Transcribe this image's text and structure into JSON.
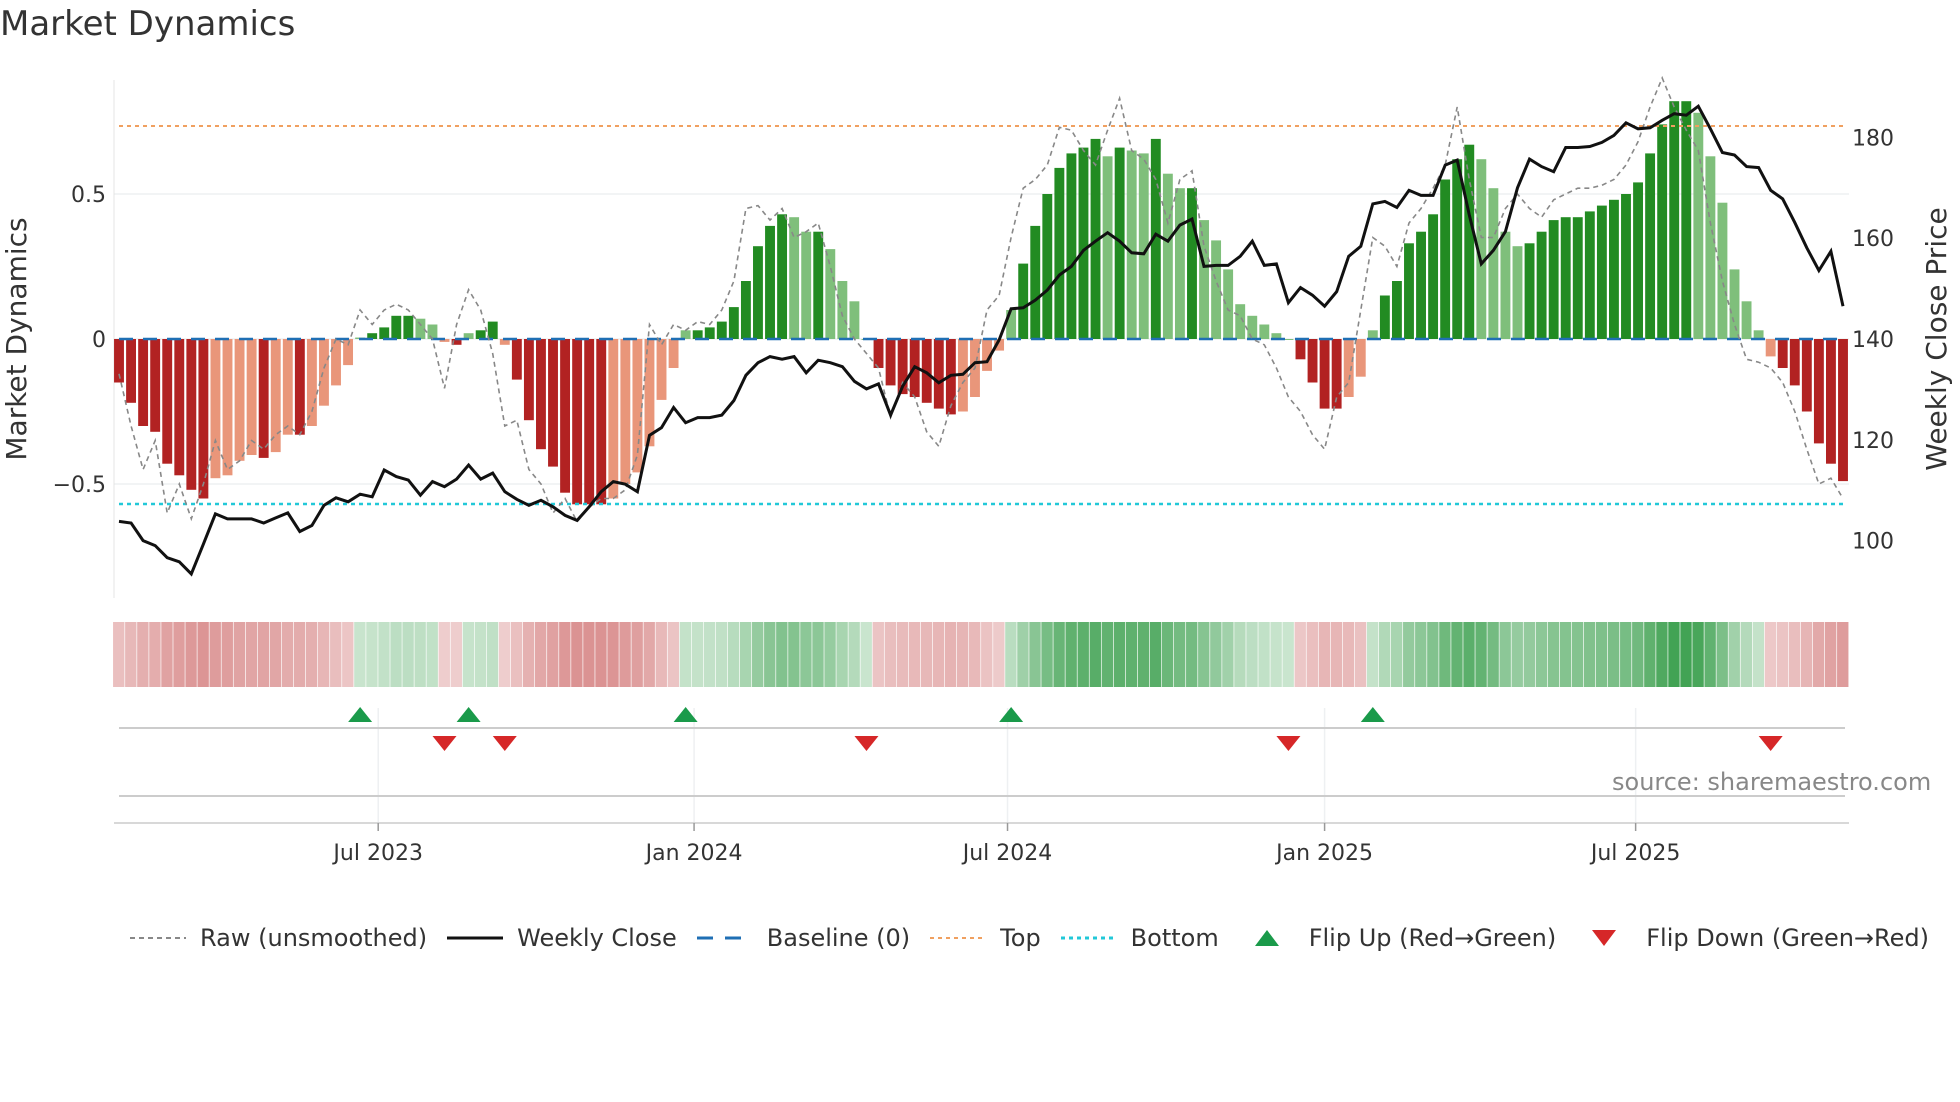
{
  "title": "Market Dynamics",
  "source": "source: sharemaestro.com",
  "legend": {
    "raw": "Raw (unsmoothed)",
    "close": "Weekly Close",
    "baseline": "Baseline (0)",
    "top": "Top",
    "bottom": "Bottom",
    "flip_up": "Flip Up (Red→Green)",
    "flip_down": "Flip Down (Green→Red)"
  },
  "colors": {
    "dark_green": "#228b22",
    "light_green": "#7fbf7b",
    "dark_red": "#b22222",
    "light_red": "#e9967a",
    "top": "#f0a060",
    "bottom": "#22c8d8",
    "baseline": "#1f6fb4",
    "up_marker": "#1a9a4a",
    "down_marker": "#d62728"
  },
  "chart_data": {
    "type": "bar",
    "title": "Market Dynamics",
    "ylabel": "Market Dynamics",
    "y2label": "Weekly Close Price",
    "ylim": [
      -0.9,
      0.9
    ],
    "y2lim": [
      90,
      190
    ],
    "yticks": [
      "0.5",
      "0",
      "−0.5"
    ],
    "yticks_values": [
      0.5,
      0,
      -0.5
    ],
    "y2ticks": [
      "180",
      "160",
      "140",
      "120",
      "100"
    ],
    "y2ticks_values": [
      180,
      160,
      140,
      120,
      100
    ],
    "xticks": [
      "Jul 2023",
      "Jan 2024",
      "Jul 2024",
      "Jan 2025",
      "Jul 2025"
    ],
    "xticks_week_index": [
      21.5,
      47.7,
      73.7,
      100,
      125.8
    ],
    "top_level": 0.73,
    "bottom_level": -0.57,
    "baseline": 0,
    "frequency": "weekly",
    "dynamics": [
      -0.15,
      -0.22,
      -0.3,
      -0.32,
      -0.43,
      -0.47,
      -0.52,
      -0.55,
      -0.48,
      -0.47,
      -0.42,
      -0.4,
      -0.41,
      -0.39,
      -0.33,
      -0.33,
      -0.3,
      -0.23,
      -0.16,
      -0.09,
      0.005,
      0.02,
      0.04,
      0.08,
      0.08,
      0.07,
      0.05,
      -0.01,
      -0.02,
      0.02,
      0.03,
      0.06,
      -0.02,
      -0.14,
      -0.28,
      -0.38,
      -0.44,
      -0.53,
      -0.57,
      -0.57,
      -0.57,
      -0.55,
      -0.5,
      -0.46,
      -0.37,
      -0.21,
      -0.1,
      0.03,
      0.03,
      0.04,
      0.06,
      0.11,
      0.2,
      0.32,
      0.39,
      0.43,
      0.42,
      0.37,
      0.37,
      0.31,
      0.2,
      0.13,
      0.0,
      -0.1,
      -0.16,
      -0.19,
      -0.2,
      -0.22,
      -0.24,
      -0.26,
      -0.25,
      -0.2,
      -0.11,
      -0.04,
      0.1,
      0.26,
      0.39,
      0.5,
      0.59,
      0.64,
      0.66,
      0.69,
      0.63,
      0.66,
      0.65,
      0.64,
      0.69,
      0.57,
      0.52,
      0.52,
      0.41,
      0.34,
      0.24,
      0.12,
      0.08,
      0.05,
      0.02,
      0.0,
      -0.07,
      -0.15,
      -0.24,
      -0.24,
      -0.2,
      -0.13,
      0.03,
      0.15,
      0.2,
      0.33,
      0.37,
      0.43,
      0.55,
      0.62,
      0.67,
      0.62,
      0.52,
      0.37,
      0.32,
      0.33,
      0.37,
      0.41,
      0.42,
      0.42,
      0.44,
      0.46,
      0.48,
      0.5,
      0.54,
      0.64,
      0.74,
      0.82,
      0.82,
      0.78,
      0.63,
      0.47,
      0.24,
      0.13,
      0.03,
      -0.06,
      -0.1,
      -0.16,
      -0.25,
      -0.36,
      -0.43,
      -0.49
    ],
    "raw": [
      -0.12,
      -0.3,
      -0.45,
      -0.35,
      -0.6,
      -0.5,
      -0.62,
      -0.5,
      -0.35,
      -0.45,
      -0.42,
      -0.35,
      -0.38,
      -0.33,
      -0.3,
      -0.33,
      -0.25,
      -0.1,
      0.0,
      -0.02,
      0.1,
      0.05,
      0.1,
      0.12,
      0.1,
      0.05,
      0.0,
      -0.17,
      0.05,
      0.17,
      0.1,
      -0.05,
      -0.3,
      -0.28,
      -0.45,
      -0.5,
      -0.6,
      -0.55,
      -0.63,
      -0.58,
      -0.55,
      -0.55,
      -0.52,
      -0.4,
      0.05,
      -0.02,
      0.05,
      0.03,
      0.06,
      0.05,
      0.1,
      0.2,
      0.45,
      0.46,
      0.41,
      0.45,
      0.35,
      0.37,
      0.4,
      0.25,
      0.08,
      0.0,
      -0.05,
      -0.1,
      -0.27,
      -0.15,
      -0.2,
      -0.32,
      -0.37,
      -0.23,
      -0.15,
      -0.1,
      0.1,
      0.15,
      0.35,
      0.52,
      0.55,
      0.6,
      0.73,
      0.72,
      0.65,
      0.6,
      0.72,
      0.83,
      0.65,
      0.62,
      0.55,
      0.4,
      0.55,
      0.58,
      0.32,
      0.2,
      0.1,
      0.08,
      0.0,
      -0.02,
      -0.1,
      -0.2,
      -0.25,
      -0.33,
      -0.38,
      -0.2,
      -0.15,
      0.1,
      0.35,
      0.32,
      0.25,
      0.4,
      0.45,
      0.52,
      0.6,
      0.8,
      0.55,
      0.35,
      0.35,
      0.45,
      0.5,
      0.45,
      0.42,
      0.48,
      0.5,
      0.52,
      0.52,
      0.53,
      0.55,
      0.6,
      0.68,
      0.8,
      0.9,
      0.8,
      0.72,
      0.65,
      0.4,
      0.2,
      0.05,
      -0.07,
      -0.08,
      -0.1,
      -0.15,
      -0.25,
      -0.38,
      -0.5,
      -0.48,
      -0.55
    ],
    "weekly_close": [
      103.8,
      103.5,
      100,
      99,
      96.6,
      95.8,
      93.4,
      99.3,
      105.3,
      104.3,
      104.3,
      104.3,
      103.5,
      104.5,
      105.5,
      101.8,
      103,
      107,
      108.5,
      107.7,
      109.2,
      108.7,
      114,
      112.7,
      112,
      109,
      111.7,
      110.7,
      112.2,
      115,
      112.2,
      113.4,
      109.7,
      108.2,
      107,
      108,
      106.7,
      105,
      104,
      106.7,
      109.7,
      111.7,
      111.2,
      109.7,
      120.9,
      122.4,
      126.4,
      123.4,
      124.4,
      124.4,
      124.9,
      127.8,
      132.8,
      135.3,
      136.5,
      136,
      136.5,
      133.3,
      135.8,
      135.3,
      134.5,
      131.6,
      130.1,
      131.1,
      124.9,
      130.6,
      134.5,
      133.3,
      131.3,
      132.8,
      133,
      135.3,
      135.5,
      139.8,
      146,
      146.2,
      147.7,
      149.7,
      152.7,
      154.4,
      157.6,
      159.4,
      161.1,
      159.4,
      157.1,
      156.9,
      160.8,
      159.4,
      162.6,
      163.8,
      154.4,
      154.6,
      154.6,
      156.4,
      159.4,
      154.6,
      154.9,
      147.2,
      150.2,
      148.7,
      146.5,
      149.4,
      156.4,
      158.4,
      166.8,
      167.3,
      166.1,
      169.5,
      168.5,
      168.5,
      174.5,
      175.5,
      164.6,
      154.9,
      157.6,
      161.3,
      170,
      175.7,
      174.2,
      173.2,
      178,
      178,
      178.2,
      179,
      180.4,
      182.9,
      181.7,
      181.9,
      183.4,
      184.7,
      184.4,
      186.2,
      181.7,
      177,
      176.5,
      174.2,
      174,
      169.5,
      167.8,
      163.1,
      158.1,
      153.6,
      157.4,
      146.5
    ],
    "flip_up_week_index": [
      20,
      29,
      47,
      74,
      104
    ],
    "flip_down_week_index": [
      27,
      32,
      62,
      97,
      137
    ],
    "grid": true,
    "legend_placement": "bottom"
  }
}
